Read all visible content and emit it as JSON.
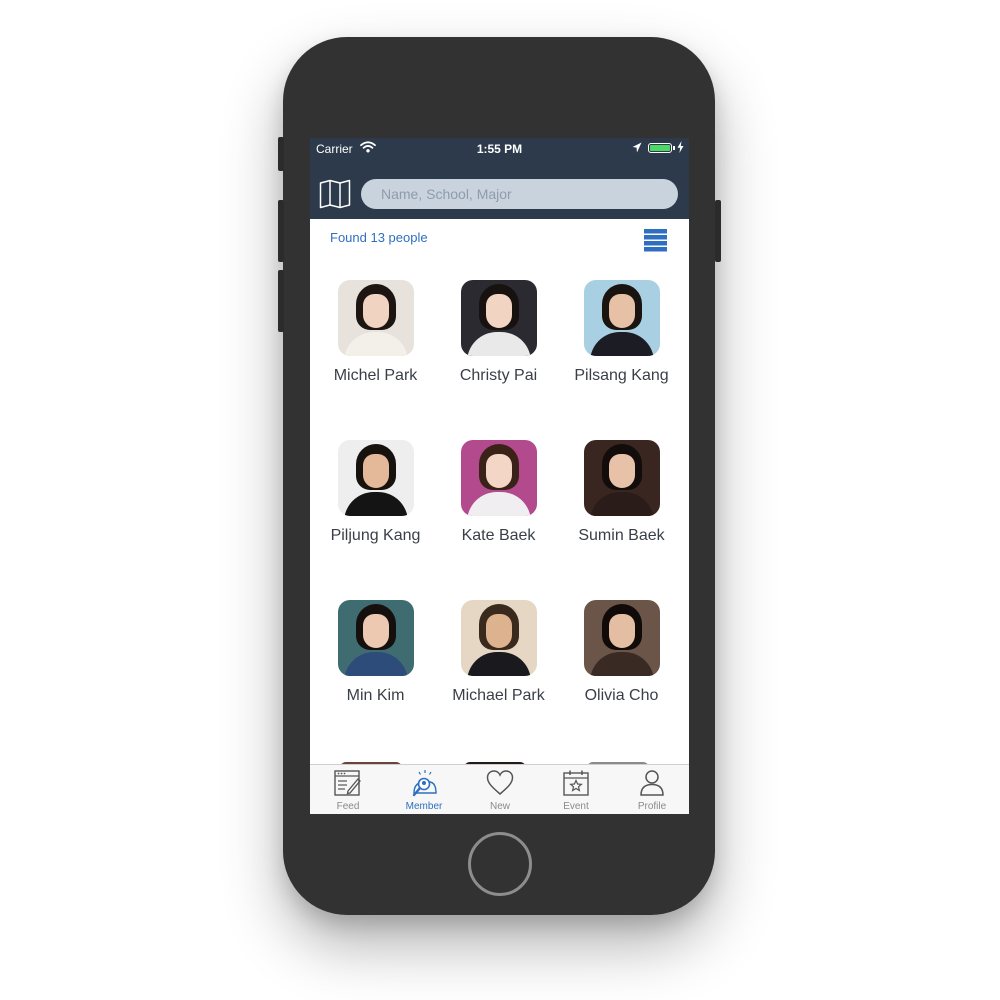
{
  "status_bar": {
    "carrier": "Carrier",
    "time": "1:55 PM",
    "battery_level": 1.0,
    "battery_color": "#4cd964"
  },
  "header": {
    "background": "#2c3a4b",
    "map_icon": "map-icon",
    "search_placeholder": "Name, School, Major",
    "search_value": ""
  },
  "results": {
    "found_text": "Found 13 people",
    "view_toggle_icon": "list-view-icon"
  },
  "members": [
    {
      "name": "Michel Park"
    },
    {
      "name": "Christy Pai"
    },
    {
      "name": "Pilsang Kang"
    },
    {
      "name": "Piljung Kang"
    },
    {
      "name": "Kate Baek"
    },
    {
      "name": "Sumin Baek"
    },
    {
      "name": "Min Kim"
    },
    {
      "name": "Michael Park"
    },
    {
      "name": "Olivia Cho"
    }
  ],
  "tab_bar": {
    "accent": "#2f6fbf",
    "active": "Member",
    "tabs": [
      {
        "label": "Feed",
        "icon": "feed-icon"
      },
      {
        "label": "Member",
        "icon": "member-search-icon"
      },
      {
        "label": "New",
        "icon": "heart-icon"
      },
      {
        "label": "Event",
        "icon": "calendar-star-icon"
      },
      {
        "label": "Profile",
        "icon": "person-icon"
      }
    ]
  }
}
